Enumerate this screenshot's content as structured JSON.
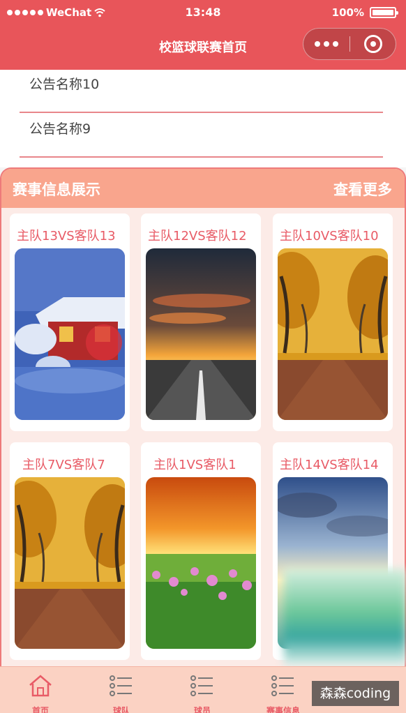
{
  "status_bar": {
    "carrier": "WeChat",
    "time": "13:48",
    "battery": "100%"
  },
  "nav": {
    "title": "校篮球联赛首页"
  },
  "notices": [
    {
      "title": "公告名称10"
    },
    {
      "title": "公告名称9"
    }
  ],
  "section": {
    "title": "赛事信息展示",
    "more_label": "查看更多"
  },
  "matches": [
    {
      "title": "主队13VS客队13",
      "image": "snowy-cabin"
    },
    {
      "title": "主队12VS客队12",
      "image": "sunset-road"
    },
    {
      "title": "主队10VS客队10",
      "image": "autumn-avenue"
    },
    {
      "title": "主队7VS客队7",
      "image": "autumn-avenue"
    },
    {
      "title": "主队1VS客队1",
      "image": "sunset-meadow"
    },
    {
      "title": "主队14VS客队14",
      "image": "sky-lake"
    }
  ],
  "tabbar": {
    "items": [
      {
        "label": "首页",
        "icon": "home-icon",
        "active": true
      },
      {
        "label": "球队",
        "icon": "list-icon"
      },
      {
        "label": "球员",
        "icon": "list-icon"
      },
      {
        "label": "赛事信息",
        "icon": "list-icon"
      }
    ]
  },
  "watermark": "森森coding",
  "colors": {
    "primary": "#e8555a",
    "section_header": "#f9a58d",
    "tabbar": "#fbd2c3",
    "accent_text": "#e85b66"
  }
}
